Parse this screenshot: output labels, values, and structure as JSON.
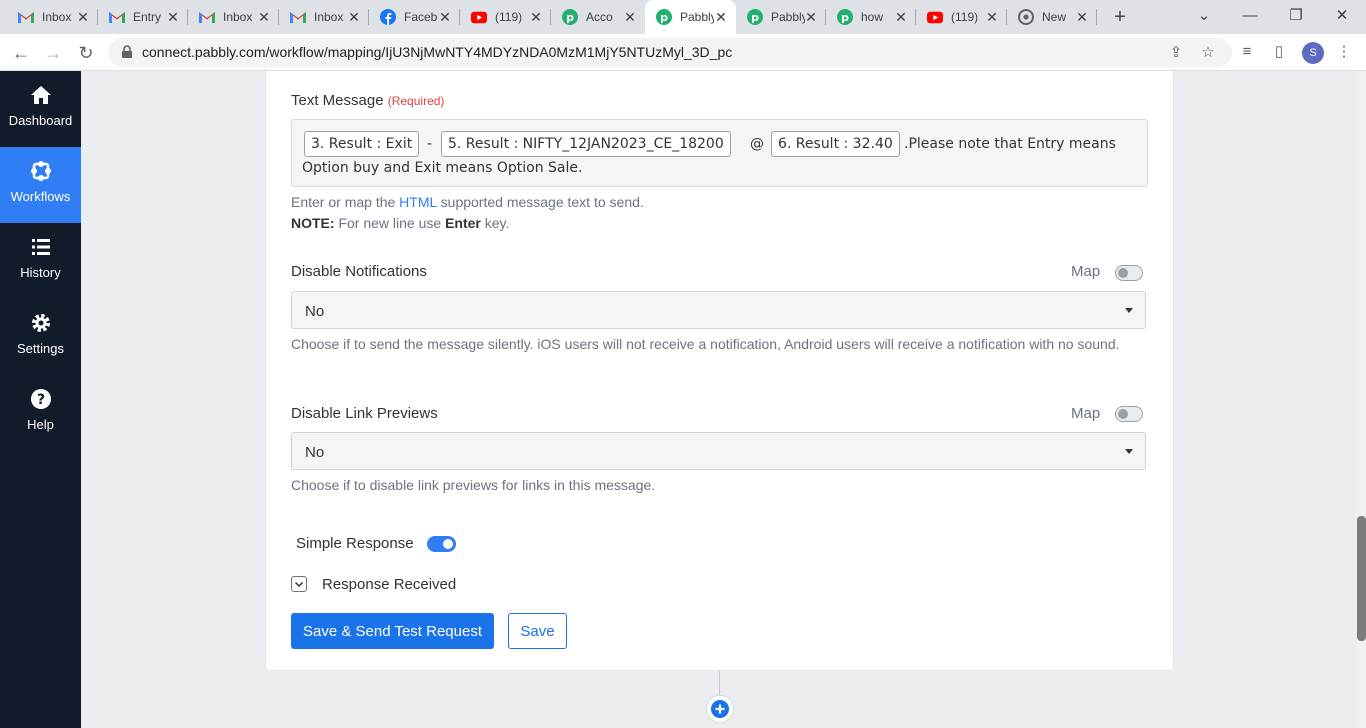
{
  "browser": {
    "tabs": [
      {
        "title": "Inbox",
        "icon": "gmail-icon"
      },
      {
        "title": "Entry",
        "icon": "gmail-icon"
      },
      {
        "title": "Inbox",
        "icon": "gmail-icon"
      },
      {
        "title": "Inbox",
        "icon": "gmail-icon"
      },
      {
        "title": "Facebook",
        "icon": "facebook-icon"
      },
      {
        "title": "(119)",
        "icon": "youtube-icon"
      },
      {
        "title": "Acco",
        "icon": "pabbly-icon"
      },
      {
        "title": "Pabbly",
        "icon": "pabbly-icon",
        "active": true
      },
      {
        "title": "Pabbly",
        "icon": "pabbly-icon"
      },
      {
        "title": "how",
        "icon": "pabbly-icon"
      },
      {
        "title": "(119)",
        "icon": "youtube-icon"
      },
      {
        "title": "New",
        "icon": "chrome-icon"
      }
    ],
    "url": "connect.pabbly.com/workflow/mapping/IjU3NjMwNTY4MDYzNDA0MzM1MjY5NTUzMyl_3D_pc",
    "profile_initial": "S"
  },
  "sidebar": {
    "items": [
      {
        "label": "Dashboard",
        "icon": "home-icon"
      },
      {
        "label": "Workflows",
        "icon": "workflow-icon",
        "active": true
      },
      {
        "label": "History",
        "icon": "history-list-icon"
      },
      {
        "label": "Settings",
        "icon": "gear-icon"
      },
      {
        "label": "Help",
        "icon": "help-icon"
      }
    ]
  },
  "form": {
    "text_message": {
      "label": "Text Message",
      "required": "(Required)",
      "tokens": [
        "3. Result : Exit",
        "5. Result : NIFTY_12JAN2023_CE_18200",
        "6. Result : 32.40"
      ],
      "sep1": "-",
      "sep2": "@",
      "tail_line1": ".Please note that Entry means",
      "tail_line2": "Option buy and Exit means Option Sale.",
      "help_pre": "Enter or map the ",
      "help_link": "HTML",
      "help_post": " supported message text to send.",
      "note_label": "NOTE:",
      "note_pre": " For new line use ",
      "note_key": "Enter",
      "note_post": " key."
    },
    "disable_notifications": {
      "label": "Disable Notifications",
      "map_label": "Map",
      "value": "No",
      "help": "Choose if to send the message silently. iOS users will not receive a notification, Android users will receive a notification with no sound."
    },
    "disable_link_previews": {
      "label": "Disable Link Previews",
      "map_label": "Map",
      "value": "No",
      "help": "Choose if to disable link previews for links in this message."
    },
    "simple_response": {
      "label": "Simple Response",
      "enabled": true
    },
    "response_received": {
      "label": "Response Received"
    },
    "buttons": {
      "save_send": "Save & Send Test Request",
      "save": "Save"
    }
  },
  "colors": {
    "accent": "#1a73e8",
    "sidebar_bg": "#121b29",
    "sidebar_active": "#2f7ef6",
    "required": "#e04141"
  }
}
